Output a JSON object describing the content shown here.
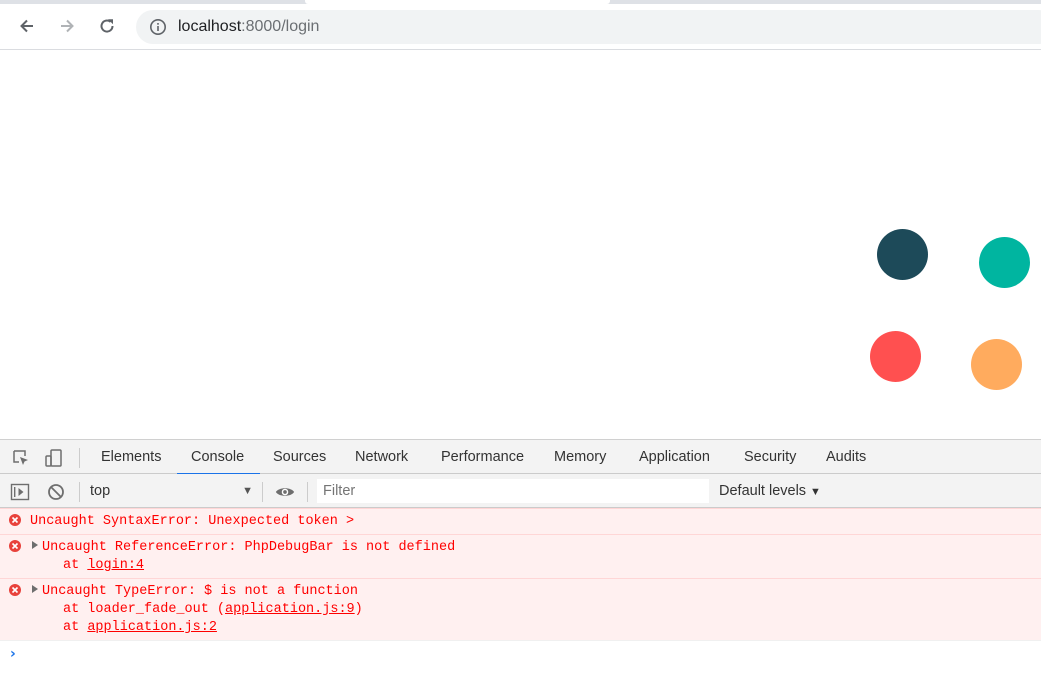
{
  "browser": {
    "url_host": "localhost",
    "url_rest": ":8000/login"
  },
  "page": {
    "dots": [
      {
        "name": "dark-teal-dot",
        "color": "#1d4a59"
      },
      {
        "name": "teal-dot",
        "color": "#00b5a0"
      },
      {
        "name": "red-dot",
        "color": "#ff5050"
      },
      {
        "name": "orange-dot",
        "color": "#ffab5e"
      }
    ]
  },
  "devtools": {
    "tabs": [
      "Elements",
      "Console",
      "Sources",
      "Network",
      "Performance",
      "Memory",
      "Application",
      "Security",
      "Audits"
    ],
    "active_tab": "Console",
    "console": {
      "context": "top",
      "filter_placeholder": "Filter",
      "levels": "Default levels",
      "messages": [
        {
          "text": "Uncaught SyntaxError: Unexpected token >",
          "expandable": false,
          "stack": []
        },
        {
          "text": "Uncaught ReferenceError: PhpDebugBar is not defined",
          "expandable": true,
          "stack": [
            {
              "prefix": "at ",
              "link": "login:4",
              "suffix": ""
            }
          ]
        },
        {
          "text": "Uncaught TypeError: $ is not a function",
          "expandable": true,
          "stack": [
            {
              "prefix": "at loader_fade_out (",
              "link": "application.js:9",
              "suffix": ")"
            },
            {
              "prefix": "at ",
              "link": "application.js:2",
              "suffix": ""
            }
          ]
        }
      ]
    }
  },
  "colors": {
    "error_text": "#ff0000",
    "error_bg": "#fff0f0",
    "accent": "#1a73e8"
  }
}
